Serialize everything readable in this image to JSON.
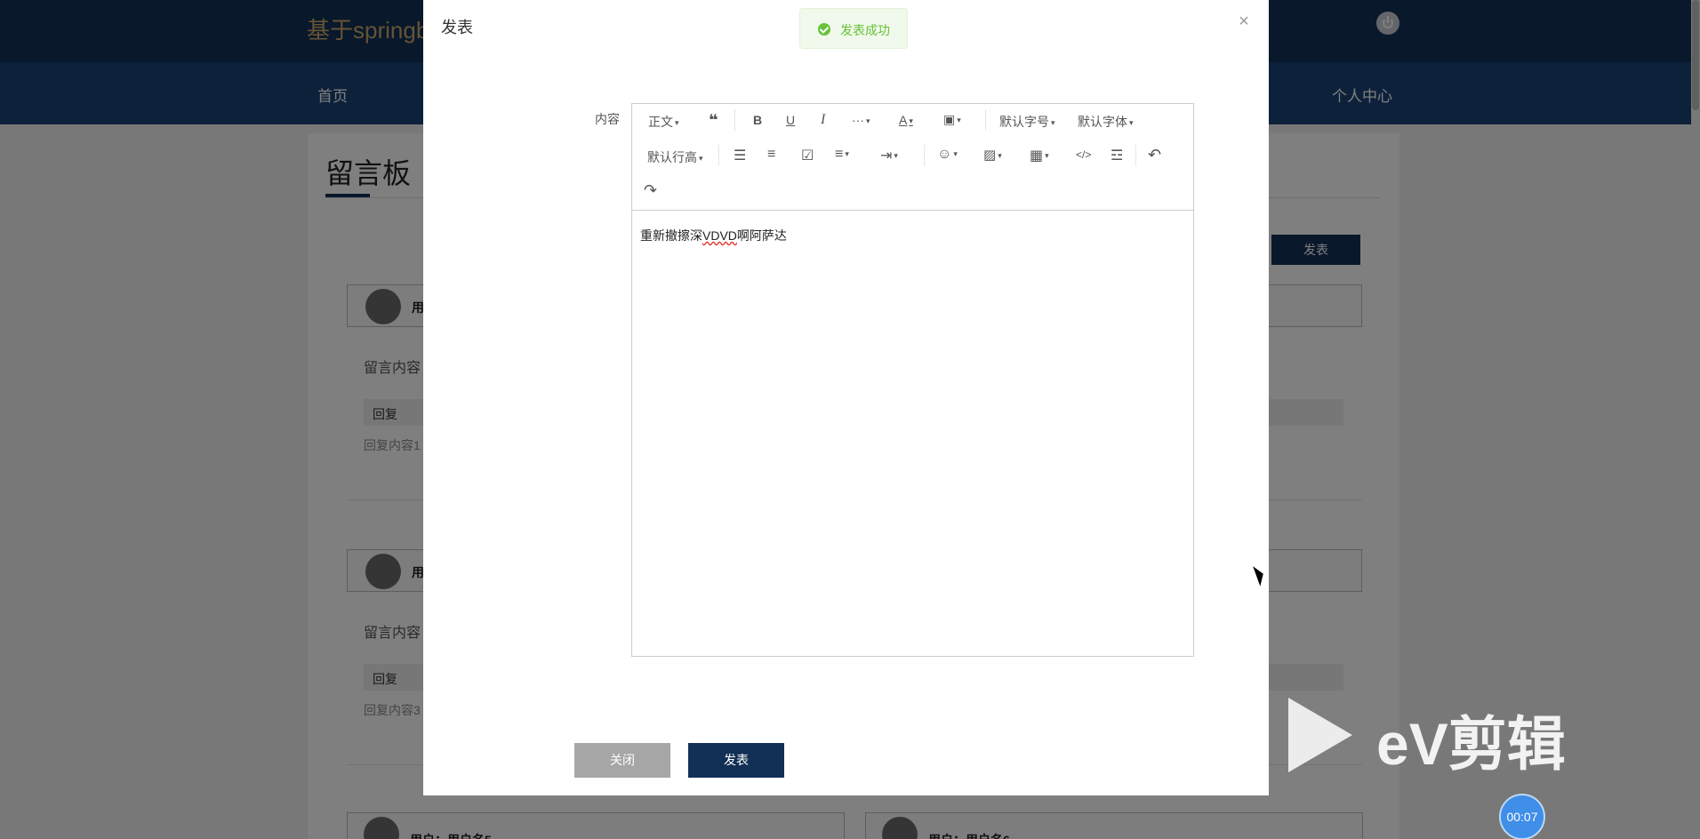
{
  "header": {
    "site_title": "基于springb",
    "nav_home": "首页",
    "nav_user_center": "个人中心"
  },
  "board": {
    "title": "留言板",
    "post_button": "发表",
    "messages": [
      {
        "user": "用",
        "content": "留言内容",
        "reply_label": "回复",
        "reply_content": "回复内容1"
      },
      {
        "user": "用",
        "content": "留言内容",
        "reply_label": "回复",
        "reply_content": "回复内容3"
      }
    ],
    "bottom_cards": [
      {
        "user": "用户：用户名5"
      },
      {
        "user": "用户：用户名6"
      }
    ]
  },
  "modal": {
    "title": "发表",
    "close_symbol": "×",
    "field_label": "内容",
    "editor_text_before": "重新撤擦深",
    "editor_text_misspelled": "VDVD",
    "editor_text_after": "啊阿萨达",
    "toolbar": {
      "paragraph": "正文",
      "font_size": "默认字号",
      "font_family": "默认字体",
      "line_height": "默认行高",
      "more": "···"
    },
    "close_button": "关闭",
    "post_button": "发表"
  },
  "toast": {
    "message": "发表成功"
  },
  "watermark": {
    "text": "eV剪辑"
  },
  "timer": {
    "text": "00:07"
  },
  "colors": {
    "primary": "#123056",
    "nav": "#1b4377",
    "success": "#67c23a",
    "title_gold": "#c9a969"
  }
}
